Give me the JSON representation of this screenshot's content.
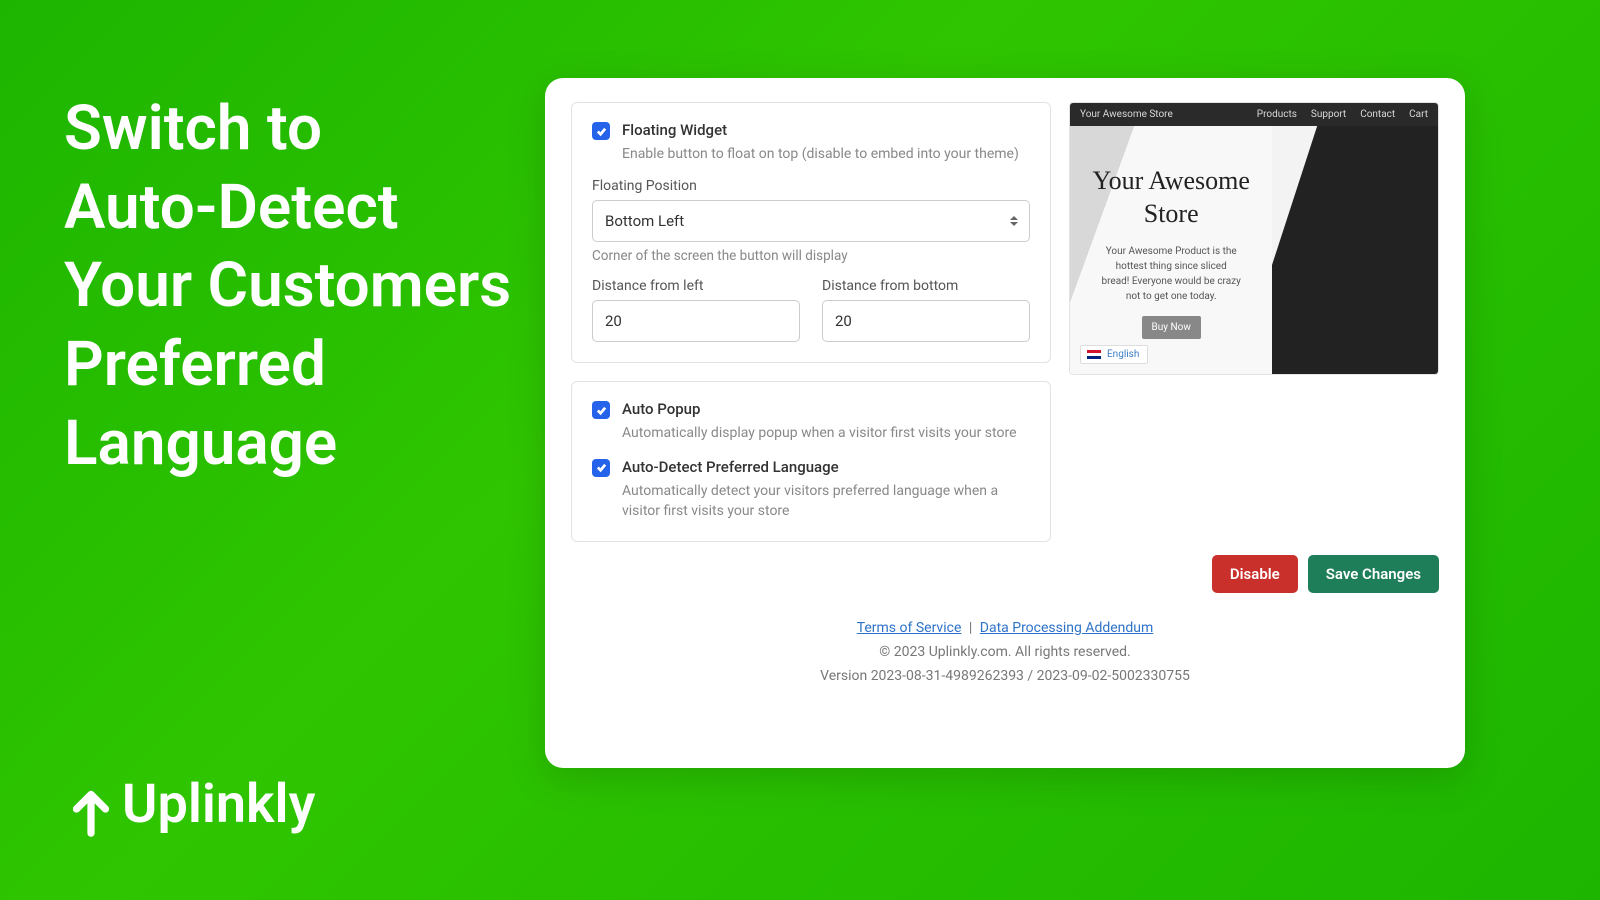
{
  "promo_headline_lines": [
    "Switch to",
    "Auto-Detect",
    "Your Customers",
    "Preferred",
    "Language"
  ],
  "brand": "Uplinkly",
  "settings": {
    "floating_widget": {
      "label": "Floating Widget",
      "description": "Enable button to float on top (disable to embed into your theme)"
    },
    "floating_position": {
      "label": "Floating Position",
      "value": "Bottom Left",
      "hint": "Corner of the screen the button will display"
    },
    "distance_left": {
      "label": "Distance from left",
      "value": "20"
    },
    "distance_bottom": {
      "label": "Distance from bottom",
      "value": "20"
    },
    "auto_popup": {
      "label": "Auto Popup",
      "description": "Automatically display popup when a visitor first visits your store"
    },
    "auto_detect": {
      "label": "Auto-Detect Preferred Language",
      "description": "Automatically detect your visitors preferred language when a visitor first visits your store"
    }
  },
  "preview": {
    "store_name": "Your Awesome Store",
    "nav_links": [
      "Products",
      "Support",
      "Contact",
      "Cart"
    ],
    "hero_title": "Your Awesome Store",
    "hero_desc": "Your Awesome Product is the hottest thing since sliced bread! Everyone would be crazy not to get one today.",
    "buy_label": "Buy Now",
    "lang_label": "English"
  },
  "actions": {
    "disable": "Disable",
    "save": "Save Changes"
  },
  "footer": {
    "tos": "Terms of Service",
    "dpa": "Data Processing Addendum",
    "copyright": "© 2023 Uplinkly.com. All rights reserved.",
    "version": "Version 2023-08-31-4989262393 / 2023-09-02-5002330755"
  }
}
